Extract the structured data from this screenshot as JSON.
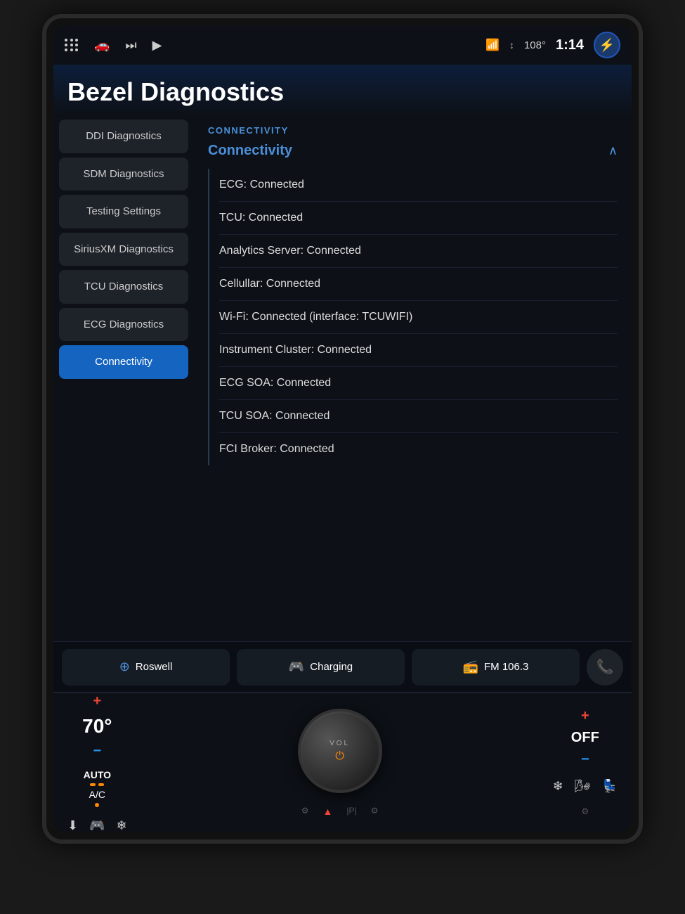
{
  "status_bar": {
    "wifi_icon": "📶",
    "signal_icon": "📶",
    "temperature": "108°",
    "time": "1:14",
    "bolt_icon": "⚡"
  },
  "page": {
    "title": "Bezel Diagnostics"
  },
  "sidebar": {
    "items": [
      {
        "id": "ddi",
        "label": "DDI Diagnostics",
        "active": false
      },
      {
        "id": "sdm",
        "label": "SDM Diagnostics",
        "active": false
      },
      {
        "id": "testing",
        "label": "Testing Settings",
        "active": false
      },
      {
        "id": "siriusxm",
        "label": "SiriusXM Diagnostics",
        "active": false
      },
      {
        "id": "tcu",
        "label": "TCU Diagnostics",
        "active": false
      },
      {
        "id": "ecg",
        "label": "ECG Diagnostics",
        "active": false
      },
      {
        "id": "connectivity",
        "label": "Connectivity",
        "active": true
      }
    ]
  },
  "connectivity": {
    "section_label": "CONNECTIVITY",
    "expand_title": "Connectivity",
    "items": [
      {
        "id": "ecg",
        "text": "ECG: Connected"
      },
      {
        "id": "tcu",
        "text": "TCU: Connected"
      },
      {
        "id": "analytics",
        "text": "Analytics Server: Connected"
      },
      {
        "id": "cellular",
        "text": "Cellullar: Connected"
      },
      {
        "id": "wifi",
        "text": "Wi-Fi: Connected (interface: TCUWIFI)"
      },
      {
        "id": "instrument",
        "text": "Instrument Cluster: Connected"
      },
      {
        "id": "ecgsoa",
        "text": "ECG SOA: Connected"
      },
      {
        "id": "tcusoa",
        "text": "TCU SOA: Connected"
      },
      {
        "id": "fci",
        "text": "FCI Broker: Connected"
      }
    ]
  },
  "bottom_widgets": [
    {
      "id": "roswell",
      "icon": "⊕",
      "icon_color": "blue",
      "label": "Roswell"
    },
    {
      "id": "charging",
      "icon": "🎮",
      "icon_color": "green",
      "label": "Charging"
    },
    {
      "id": "fm",
      "icon": "📻",
      "icon_color": "red",
      "label": "FM 106.3"
    }
  ],
  "controls": {
    "temp": "70°",
    "auto": "AUTO",
    "ac": "A/C",
    "vol_label": "VOL",
    "off_label": "OFF"
  },
  "nav_icons": [
    "⚙",
    "▲",
    "|P|",
    "⚙"
  ]
}
